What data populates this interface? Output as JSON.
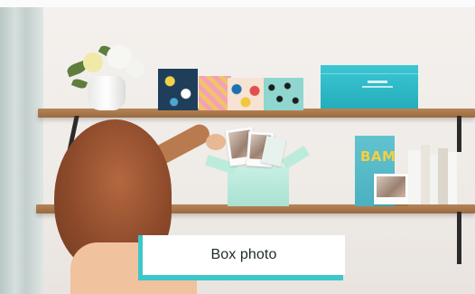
{
  "card": {
    "label": "Box photo"
  },
  "colors": {
    "accent": "#3cc7cb",
    "label_background": "#ffffff",
    "label_text": "#1f2a2c",
    "wall": "#f0ece8",
    "shelf_wood": "#a87648"
  },
  "scene": {
    "bag_text": "BAM"
  }
}
